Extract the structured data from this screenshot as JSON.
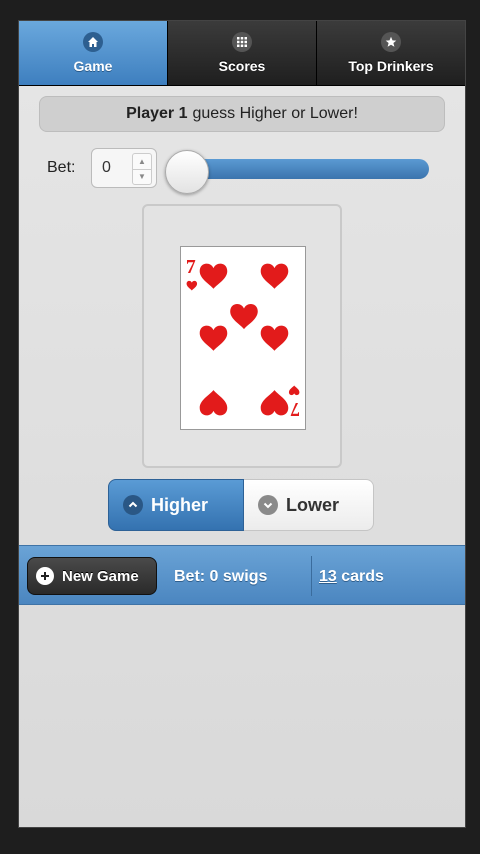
{
  "nav": {
    "tabs": [
      {
        "label": "Game",
        "icon": "home-icon",
        "active": true
      },
      {
        "label": "Scores",
        "icon": "grid-icon",
        "active": false
      },
      {
        "label": "Top Drinkers",
        "icon": "star-icon",
        "active": false
      }
    ]
  },
  "banner": {
    "player": "Player 1",
    "text": "guess Higher or Lower!"
  },
  "bet": {
    "label": "Bet:",
    "value": "0",
    "slider_fraction": 0
  },
  "card": {
    "rank": "7",
    "suit": "hearts",
    "color": "#e21b1b"
  },
  "choices": {
    "higher": "Higher",
    "lower": "Lower",
    "selected": "higher"
  },
  "footer": {
    "new_game_label": "New Game",
    "bet_status": "Bet: 0 swigs",
    "cards_count": "13",
    "cards_label": "cards"
  },
  "colors": {
    "accent": "#4b86c0",
    "dark": "#2a2a2a"
  }
}
